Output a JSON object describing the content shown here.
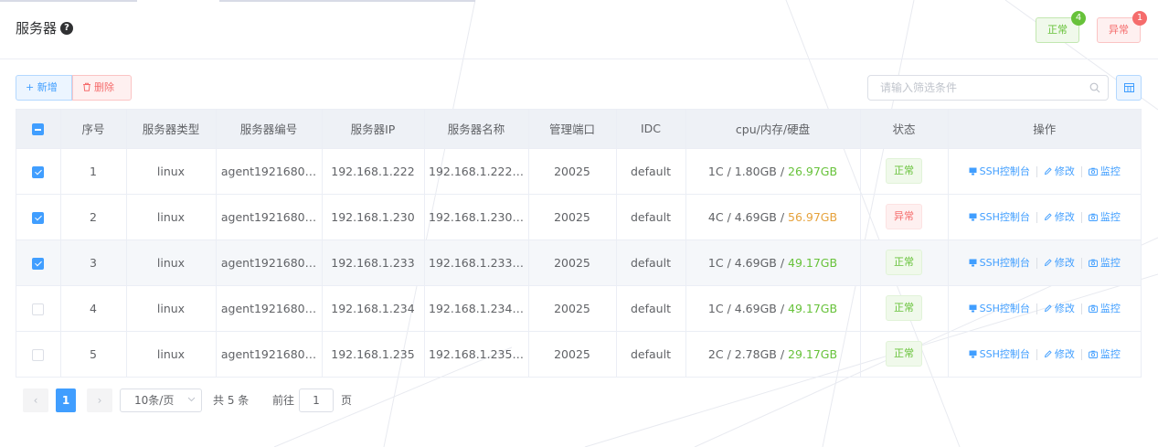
{
  "page": {
    "title": "服务器",
    "help_icon": "question-circle-icon"
  },
  "status_cards": {
    "ok": {
      "label": "正常",
      "count": "4",
      "color": "#67c23a"
    },
    "bad": {
      "label": "异常",
      "count": "1",
      "color": "#f56c6c"
    }
  },
  "toolbar": {
    "add_label": "+ 新增",
    "delete_label": "删除",
    "delete_icon": "trash-icon",
    "column_icon": "columns-icon"
  },
  "search": {
    "placeholder": "请输入筛选条件",
    "value": "",
    "icon": "search-icon"
  },
  "table": {
    "headers": [
      "",
      "序号",
      "服务器类型",
      "服务器编号",
      "服务器IP",
      "服务器名称",
      "管理端口",
      "IDC",
      "cpu/内存/硬盘",
      "状态",
      "操作"
    ],
    "rows": [
      {
        "checked": true,
        "index": "1",
        "type": "linux",
        "code": "agent1921680…",
        "ip": "192.168.1.222",
        "name": "192.168.1.222…",
        "port": "20025",
        "idc": "default",
        "cpu_mem": "1C / 1.80GB / ",
        "disk": "26.97GB",
        "disk_tone": "green",
        "status": "正常",
        "status_tone": "ok"
      },
      {
        "checked": true,
        "index": "2",
        "type": "linux",
        "code": "agent1921680…",
        "ip": "192.168.1.230",
        "name": "192.168.1.230…",
        "port": "20025",
        "idc": "default",
        "cpu_mem": "4C / 4.69GB / ",
        "disk": "56.97GB",
        "disk_tone": "orange",
        "status": "异常",
        "status_tone": "bad"
      },
      {
        "checked": true,
        "index": "3",
        "type": "linux",
        "code": "agent1921680…",
        "ip": "192.168.1.233",
        "name": "192.168.1.233…",
        "port": "20025",
        "idc": "default",
        "cpu_mem": "1C / 4.69GB / ",
        "disk": "49.17GB",
        "disk_tone": "green",
        "status": "正常",
        "status_tone": "ok"
      },
      {
        "checked": false,
        "index": "4",
        "type": "linux",
        "code": "agent1921680…",
        "ip": "192.168.1.234",
        "name": "192.168.1.234…",
        "port": "20025",
        "idc": "default",
        "cpu_mem": "1C / 4.69GB / ",
        "disk": "49.17GB",
        "disk_tone": "green",
        "status": "正常",
        "status_tone": "ok"
      },
      {
        "checked": false,
        "index": "5",
        "type": "linux",
        "code": "agent1921680…",
        "ip": "192.168.1.235",
        "name": "192.168.1.235…",
        "port": "20025",
        "idc": "default",
        "cpu_mem": "2C / 2.78GB / ",
        "disk": "29.17GB",
        "disk_tone": "green",
        "status": "正常",
        "status_tone": "ok"
      }
    ],
    "actions": {
      "ssh": "SSH控制台",
      "edit": "修改",
      "monitor": "监控"
    }
  },
  "pagination": {
    "current": "1",
    "page_size": "10条/页",
    "total": "共 5 条",
    "goto_label": "前往",
    "goto_value": "1",
    "page_unit": "页"
  },
  "colors": {
    "primary": "#409eff",
    "success": "#67c23a",
    "danger": "#f56c6c",
    "warning": "#e6a23c"
  }
}
